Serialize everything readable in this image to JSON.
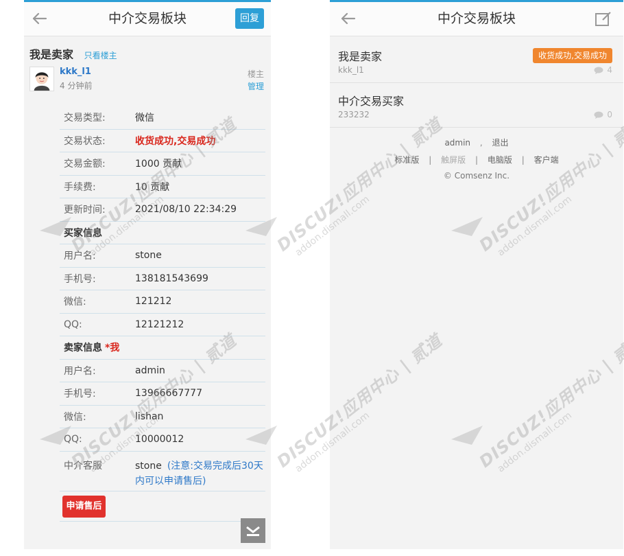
{
  "left_screen": {
    "header": {
      "title": "中介交易板块",
      "reply_label": "回复"
    },
    "thread": {
      "title": "我是卖家",
      "only_op_label": "只看楼主",
      "author": "kkk_l1",
      "time": "4 分钟前",
      "op_label": "楼主",
      "manage_label": "管理"
    },
    "trade": {
      "type_label": "交易类型:",
      "type_value": "微信",
      "status_label": "交易状态:",
      "status_value": "收货成功,交易成功",
      "amount_label": "交易金额:",
      "amount_value": "1000 贡献",
      "fee_label": "手续费:",
      "fee_value": "10 贡献",
      "updated_label": "更新时间:",
      "updated_value": "2021/08/10 22:34:29",
      "buyer_section": "买家信息",
      "buyer_username_label": "用户名:",
      "buyer_username": "stone",
      "buyer_phone_label": "手机号:",
      "buyer_phone": "138181543699",
      "buyer_wechat_label": "微信:",
      "buyer_wechat": "121212",
      "buyer_qq_label": "QQ:",
      "buyer_qq": "12121212",
      "seller_section": "卖家信息",
      "seller_mark": "*我",
      "seller_username_label": "用户名:",
      "seller_username": "admin",
      "seller_phone_label": "手机号:",
      "seller_phone": "13966667777",
      "seller_wechat_label": "微信:",
      "seller_wechat": "lishan",
      "seller_qq_label": "QQ:",
      "seller_qq": "10000012",
      "agent_label": "中介客服",
      "agent_value": "stone",
      "agent_note": "(注意:交易完成后30天内可以申请售后)"
    },
    "after_sale_label": "申请售后"
  },
  "right_screen": {
    "header": {
      "title": "中介交易板块"
    },
    "threads": [
      {
        "title": "我是卖家",
        "author": "kkk_l1",
        "badge": "收货成功,交易成功",
        "comments": "4"
      },
      {
        "title": "中介交易买家",
        "author": "233232",
        "comments": "0"
      }
    ],
    "footer": {
      "user": "admin",
      "comma": ",",
      "logout": "退出",
      "links": [
        "标准版",
        "触屏版",
        "电脑版",
        "客户端"
      ],
      "copyright": "© Comsenz Inc."
    }
  },
  "watermark": {
    "main": "DISCUZ!应用中心 | 贰道",
    "sub": "addon.dismall.com"
  },
  "colors": {
    "accent": "#2d9fd6",
    "status_red": "#d9261c",
    "badge_orange": "#f0862e",
    "after_sale_red": "#e1322d"
  },
  "icons": [
    "back-arrow-icon",
    "edit-icon",
    "comment-icon",
    "chevron-down-icon",
    "avatar"
  ]
}
